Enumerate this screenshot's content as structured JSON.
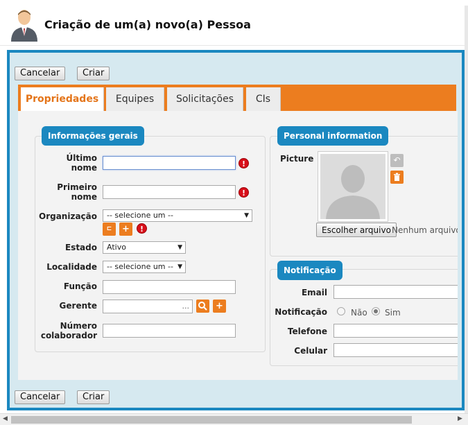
{
  "header": {
    "title": "Criação de um(a) novo(a) Pessoa"
  },
  "toolbar": {
    "cancel_label": "Cancelar",
    "create_label": "Criar"
  },
  "tabs": [
    {
      "label": "Propriedades",
      "active": true
    },
    {
      "label": "Equipes"
    },
    {
      "label": "Solicitações"
    },
    {
      "label": "CIs"
    }
  ],
  "general": {
    "legend": "Informações gerais",
    "last_name_label": "Último nome",
    "last_name_value": "",
    "first_name_label": "Primeiro nome",
    "first_name_value": "",
    "organization_label": "Organização",
    "organization_value": "-- selecione um --",
    "state_label": "Estado",
    "state_value": "Ativo",
    "location_label": "Localidade",
    "location_value": "-- selecione um --",
    "function_label": "Função",
    "function_value": "",
    "manager_label": "Gerente",
    "manager_value": "...",
    "employee_number_label": "Número colaborador",
    "employee_number_value": ""
  },
  "personal": {
    "legend": "Personal information",
    "picture_label": "Picture",
    "file_button": "Escolher arquivo",
    "file_status": "Nenhum arquivo se"
  },
  "notification": {
    "legend": "Notificação",
    "email_label": "Email",
    "email_value": "",
    "notification_label": "Notificação",
    "option_no": "Não",
    "option_yes": "Sim",
    "selected": "Sim",
    "phone_label": "Telefone",
    "phone_value": "",
    "mobile_label": "Celular",
    "mobile_value": ""
  },
  "colors": {
    "accent_blue": "#1b88c0",
    "tab_orange": "#ec7d1f",
    "error_red": "#d80f1a"
  },
  "icons": [
    "person-icon",
    "error-icon",
    "tree-icon",
    "plus-icon",
    "search-icon",
    "undo-icon",
    "trash-icon"
  ]
}
